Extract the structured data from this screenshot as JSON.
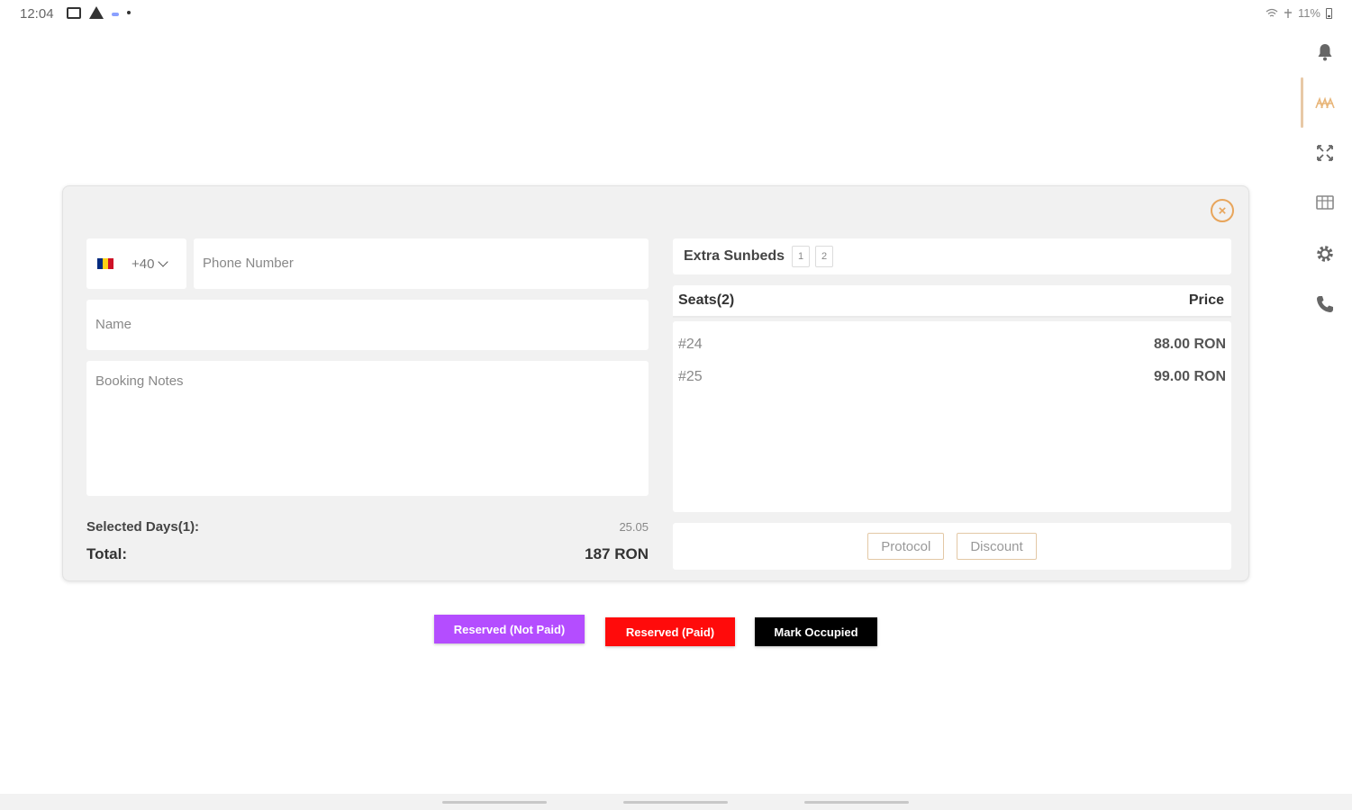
{
  "status_bar": {
    "time": "12:04",
    "battery": "11%"
  },
  "rail": {
    "items": [
      {
        "icon": "bell-icon"
      },
      {
        "icon": "sunbeds-icon",
        "active": true
      },
      {
        "icon": "expand-icon"
      },
      {
        "icon": "grid-icon"
      },
      {
        "icon": "gear-icon"
      },
      {
        "icon": "phone-icon"
      }
    ]
  },
  "modal": {
    "close_symbol": "×",
    "country": {
      "flag_colors": [
        "#002B7F",
        "#FCD116",
        "#CE1126"
      ],
      "dial_code": "+40"
    },
    "phone_placeholder": "Phone Number",
    "name_placeholder": "Name",
    "notes_placeholder": "Booking Notes",
    "selected_days_label": "Selected Days(1):",
    "selected_days_value": "25.05",
    "total_label": "Total:",
    "total_value": "187 RON",
    "extra_sunbeds": {
      "label": "Extra Sunbeds",
      "options": [
        "1",
        "2"
      ]
    },
    "seats": {
      "header_label": "Seats(2)",
      "price_header": "Price",
      "rows": [
        {
          "seat": "#24",
          "price": "88.00 RON"
        },
        {
          "seat": "#25",
          "price": "99.00 RON"
        }
      ]
    },
    "protocol_label": "Protocol",
    "discount_label": "Discount"
  },
  "actions": {
    "reserved_not_paid": "Reserved (Not Paid)",
    "reserved_paid": "Reserved (Paid)",
    "mark_occupied": "Mark Occupied"
  },
  "colors": {
    "accent": "#e8a55b",
    "not_paid": "#b44dff",
    "paid": "#ff0b0b",
    "occupied": "#000000"
  }
}
